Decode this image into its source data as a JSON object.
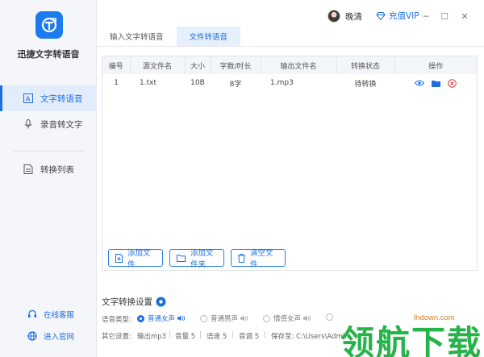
{
  "app": {
    "name": "迅捷文字转语音"
  },
  "sidebar": {
    "items": [
      {
        "label": "文字转语音",
        "icon": "text-to-speech-icon",
        "active": true
      },
      {
        "label": "录音转文字",
        "icon": "microphone-icon",
        "active": false
      },
      {
        "label": "转换列表",
        "icon": "convert-list-icon",
        "active": false
      }
    ],
    "footer": [
      {
        "label": "在线客服",
        "icon": "headset-icon"
      },
      {
        "label": "进入官网",
        "icon": "globe-icon"
      }
    ]
  },
  "titlebar": {
    "username": "晚清",
    "vip_label": "充值VIP",
    "minimize": "─",
    "maximize": "☐",
    "close": "✕"
  },
  "tabs": [
    {
      "label": "输入文字转语音",
      "active": false
    },
    {
      "label": "文件转语音",
      "active": true
    }
  ],
  "table": {
    "headers": [
      "编号",
      "源文件名",
      "大小",
      "字数/时长",
      "输出文件名",
      "转换状态",
      "操作"
    ],
    "rows": [
      {
        "index": "1",
        "source": "1.txt",
        "size": "10B",
        "length": "8字",
        "output": "1.mp3",
        "status": "待转换"
      }
    ]
  },
  "buttons": {
    "add_file": "添加文件",
    "add_folder": "添加文件夹",
    "clear_files": "清空文件"
  },
  "settings": {
    "title": "文字转换设置",
    "voice_label": "语音类型:",
    "voices": [
      {
        "label": "普通女声",
        "selected": true
      },
      {
        "label": "普通男声",
        "selected": false
      },
      {
        "label": "情感女声",
        "selected": false
      }
    ],
    "other_label": "其它设置:",
    "output": "输出mp3",
    "volume": "音量 5",
    "speed": "语速 5",
    "pitch": "音调 5",
    "save_to": "保存至: C:\\Users\\Admini"
  },
  "watermark": {
    "text": "领航下载",
    "url": "lhdown.com"
  },
  "colors": {
    "accent": "#1d6fe0",
    "sidebar_bg": "#f4f6fa",
    "watermark_green": "#26b34a",
    "watermark_orange": "#e07a1f",
    "delete_red": "#e0393e"
  }
}
